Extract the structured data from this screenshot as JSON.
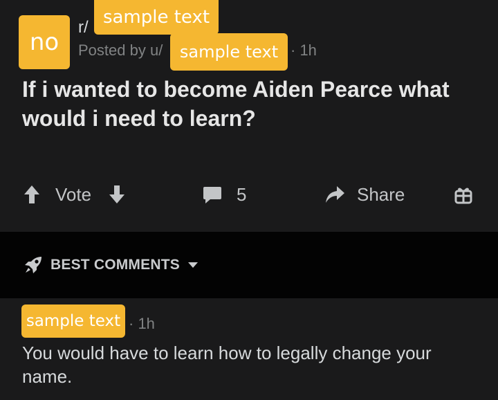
{
  "post": {
    "avatar_label": "no",
    "subreddit_prefix": "r/",
    "subreddit_name": "sample text",
    "posted_by": "Posted by u/",
    "username": "sample text",
    "time": "· 1h",
    "title": "If i wanted to become Aiden Pearce what would i need to learn?"
  },
  "actions": {
    "vote_label": "Vote",
    "comment_count": "5",
    "share_label": "Share"
  },
  "sort": {
    "label": "BEST COMMENTS"
  },
  "comment": {
    "username": "sample text",
    "time": "· 1h",
    "body": "You would have to learn how to legally change your name."
  },
  "icons": {
    "upvote": "arrow-up-icon",
    "downvote": "arrow-down-icon",
    "comments": "speech-bubble-icon",
    "share": "share-arrow-icon",
    "award": "gift-icon",
    "sort": "rocket-icon",
    "dropdown": "chevron-down-icon"
  },
  "colors": {
    "background": "#1a1a1b",
    "separator": "#030303",
    "badge": "#f5b731",
    "muted_text": "#818384"
  }
}
